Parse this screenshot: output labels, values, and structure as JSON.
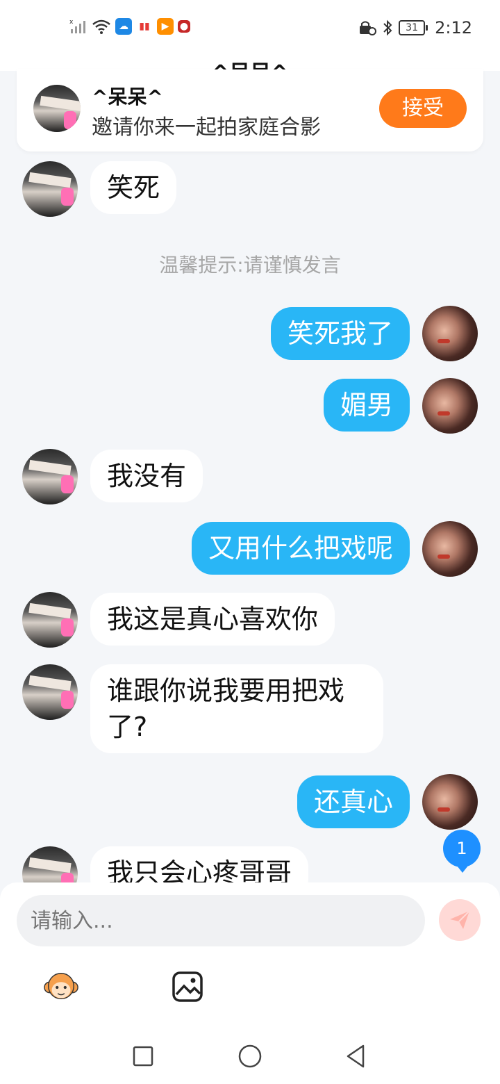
{
  "status_bar": {
    "time": "2:12",
    "battery": "31"
  },
  "header": {
    "title": "^呆呆^"
  },
  "invite": {
    "name": "^呆呆^",
    "message": "邀请你来一起拍家庭合影",
    "accept_label": "接受"
  },
  "notice": "温馨提示:请谨慎发言",
  "messages": [
    {
      "side": "left",
      "text": "笑死"
    },
    {
      "side": "right",
      "text": "笑死我了"
    },
    {
      "side": "right",
      "text": "媚男"
    },
    {
      "side": "left",
      "text": "我没有"
    },
    {
      "side": "right",
      "text": "又用什么把戏呢"
    },
    {
      "side": "left",
      "text": "我这是真心喜欢你"
    },
    {
      "side": "left",
      "text": "谁跟你说我要用把戏了?"
    },
    {
      "side": "right",
      "text": "还真心"
    },
    {
      "side": "left",
      "text": "我只会心疼哥哥"
    }
  ],
  "unread_count": "1",
  "composer": {
    "placeholder": "请输入..."
  },
  "colors": {
    "accent_blue": "#29b6f6",
    "accept_orange": "#ff7a1a",
    "background": "#f4f6f9"
  },
  "icons": [
    "send-icon",
    "emoji-monkey-icon",
    "image-icon",
    "recent-apps-icon",
    "home-icon",
    "back-icon"
  ]
}
